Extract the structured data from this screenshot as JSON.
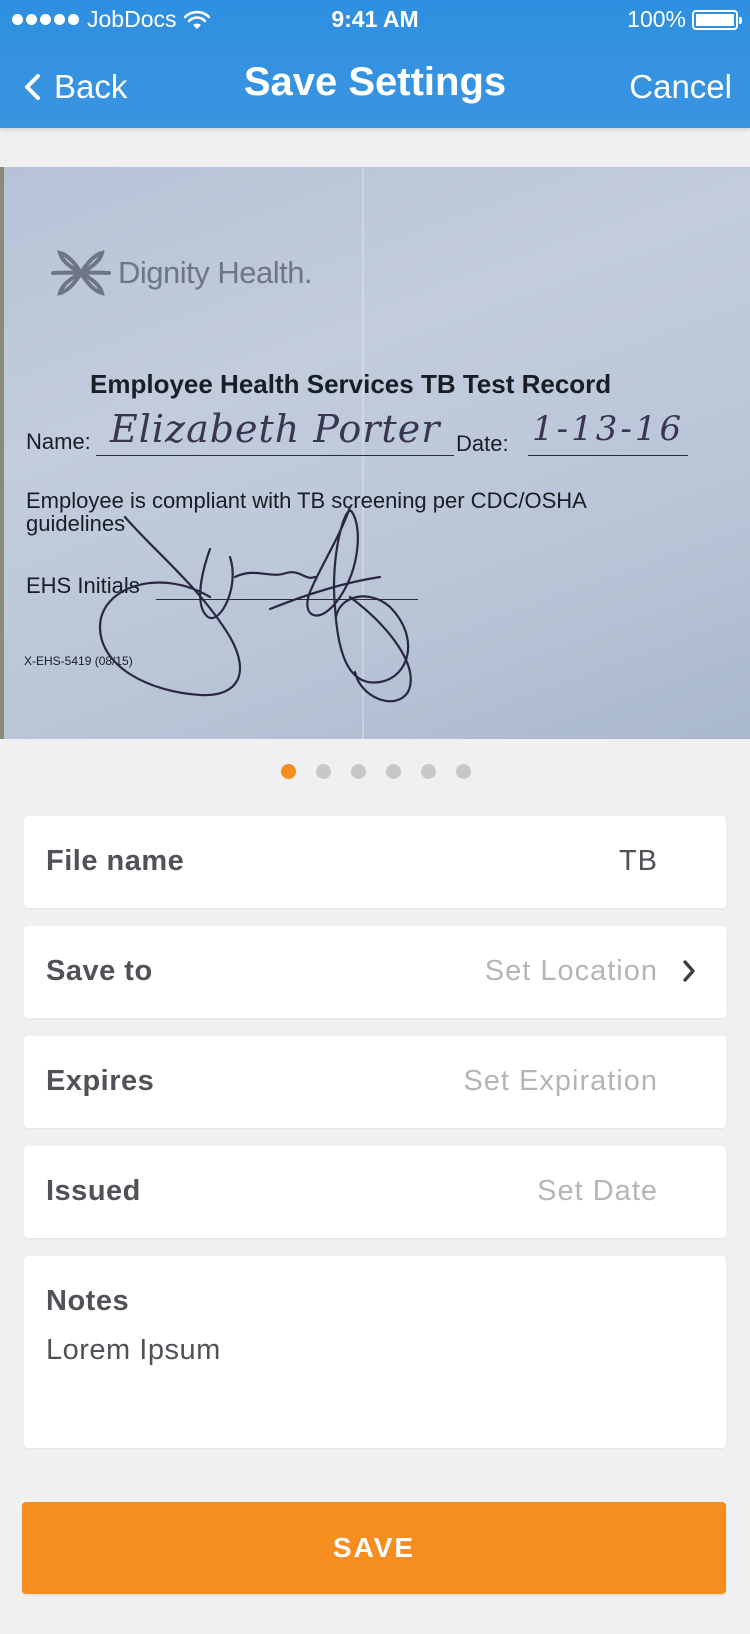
{
  "status_bar": {
    "carrier": "JobDocs",
    "time": "9:41 AM",
    "battery": "100%",
    "battery_level": 1.0
  },
  "nav": {
    "back_label": "Back",
    "title": "Save Settings",
    "cancel_label": "Cancel"
  },
  "document_image": {
    "logo_text": "Dignity Health.",
    "title": "Employee Health Services TB Test Record",
    "name_label": "Name:",
    "name_value": "Elizabeth Porter",
    "date_label": "Date:",
    "date_value": "1-13-16",
    "compliance_text": "Employee is compliant with TB screening per CDC/OSHA guidelines",
    "ehs_initials_label": "EHS Initials",
    "form_code": "X-EHS-5419 (08/15)"
  },
  "pager": {
    "page_count": 6,
    "active_index": 0
  },
  "form": {
    "file_name": {
      "label": "File name",
      "value": "TB"
    },
    "save_to": {
      "label": "Save to",
      "placeholder": "Set Location"
    },
    "expires": {
      "label": "Expires",
      "placeholder": "Set Expiration"
    },
    "issued": {
      "label": "Issued",
      "placeholder": "Set Date"
    },
    "notes": {
      "label": "Notes",
      "value": "Lorem Ipsum"
    }
  },
  "save_button": {
    "label": "SAVE"
  },
  "colors": {
    "header_blue": "#3a95e0",
    "accent_orange": "#f58d1f",
    "label_gray": "#505257",
    "placeholder_gray": "#b4b5b8",
    "background": "#f0f0f0"
  },
  "icons": [
    "signal-dots-icon",
    "wifi-icon",
    "battery-icon",
    "back-chevron-icon",
    "chevron-right-icon",
    "dignity-health-logo-icon"
  ]
}
